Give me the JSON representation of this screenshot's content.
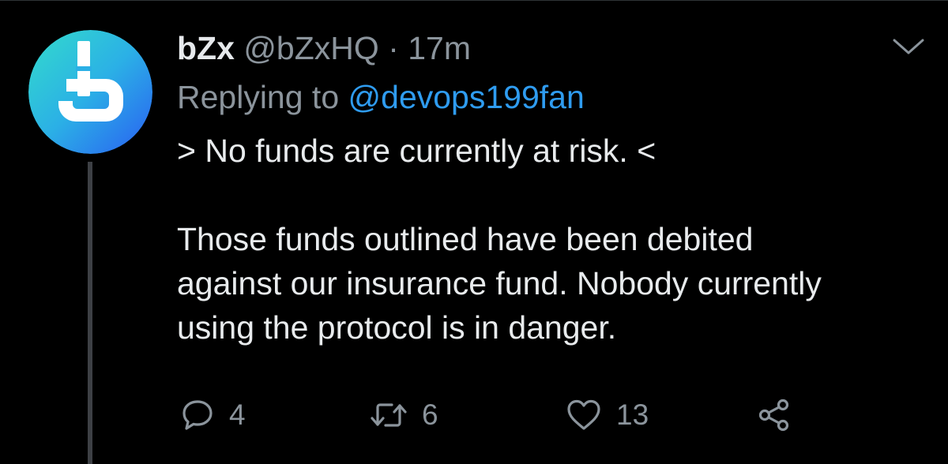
{
  "tweet": {
    "display_name": "bZx",
    "handle": "@bZxHQ",
    "separator": "·",
    "time": "17m",
    "reply_prefix": "Replying to",
    "reply_mention": "@devops199fan",
    "text_line1": "> No funds are currently at risk. <",
    "text_paragraph2_line1": "Those funds outlined have been debited",
    "text_paragraph2_line2": "against our insurance fund. Nobody currently",
    "text_paragraph2_line3": "using the protocol is in danger."
  },
  "actions": {
    "reply_count": "4",
    "retweet_count": "6",
    "like_count": "13"
  },
  "icons": {
    "avatar": "bzx-logo-icon",
    "caret": "chevron-down-icon",
    "reply": "comment-icon",
    "retweet": "retweet-icon",
    "like": "heart-icon",
    "share": "share-icon"
  },
  "colors": {
    "background": "#000000",
    "text_primary": "#e8ebed",
    "text_secondary": "#8b949c",
    "link": "#2f9cf0",
    "avatar_gradient_start": "#2fd3c6",
    "avatar_gradient_end": "#2a6cf0"
  }
}
